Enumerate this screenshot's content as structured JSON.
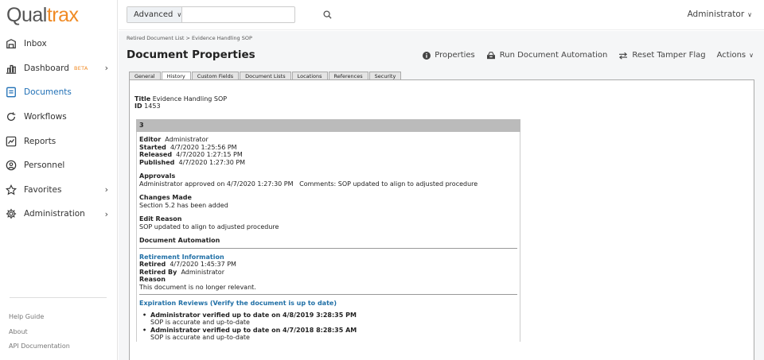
{
  "app": {
    "logo_main": "Qual",
    "logo_accent": "trax"
  },
  "search": {
    "mode": "Advanced",
    "placeholder": ""
  },
  "user": {
    "name": "Administrator"
  },
  "sidebar": {
    "items": [
      {
        "label": "Inbox",
        "icon": "inbox-icon"
      },
      {
        "label": "Dashboard",
        "badge": "BETA",
        "icon": "dashboard-icon",
        "has_children": true
      },
      {
        "label": "Documents",
        "icon": "document-icon",
        "active": true
      },
      {
        "label": "Workflows",
        "icon": "workflow-icon"
      },
      {
        "label": "Reports",
        "icon": "reports-icon"
      },
      {
        "label": "Personnel",
        "icon": "personnel-icon"
      },
      {
        "label": "Favorites",
        "icon": "star-icon",
        "has_children": true
      },
      {
        "label": "Administration",
        "icon": "gear-icon",
        "has_children": true
      }
    ],
    "footer_links": [
      "Help Guide",
      "About",
      "API Documentation"
    ]
  },
  "breadcrumb": {
    "parent": "Retired Document List",
    "separator": ">",
    "current": "Evidence Handling SOP"
  },
  "page": {
    "title": "Document Properties"
  },
  "actions": {
    "properties": "Properties",
    "run_automation": "Run Document Automation",
    "reset_tamper": "Reset Tamper Flag",
    "actions": "Actions"
  },
  "tabs": [
    "General",
    "History",
    "Custom Fields",
    "Document Lists",
    "Locations",
    "References",
    "Security"
  ],
  "active_tab": "History",
  "document": {
    "title_label": "Title",
    "title": "Evidence Handling SOP",
    "id_label": "ID",
    "id": "1453"
  },
  "history": {
    "version": "3",
    "editor_label": "Editor",
    "editor": "Administrator",
    "started_label": "Started",
    "started": "4/7/2020 1:25:56 PM",
    "released_label": "Released",
    "released": "4/7/2020 1:27:15 PM",
    "published_label": "Published",
    "published": "4/7/2020 1:27:30 PM",
    "approvals_label": "Approvals",
    "approvals": "Administrator approved on 4/7/2020 1:27:30 PM   Comments: SOP updated to align to adjusted procedure",
    "changes_label": "Changes Made",
    "changes": "Section 5.2 has been added",
    "edit_reason_label": "Edit Reason",
    "edit_reason": "SOP updated to align to adjusted procedure",
    "automation_label": "Document Automation",
    "retirement_title": "Retirement Information",
    "retired_label": "Retired",
    "retired": "4/7/2020 1:45:37 PM",
    "retired_by_label": "Retired By",
    "retired_by": "Administrator",
    "reason_label": "Reason",
    "reason": "This document is no longer relevant.",
    "expiration_title": "Expiration Reviews (Verify the document is up to date)",
    "reviews": [
      {
        "heading": "Administrator verified up to date on 4/8/2019 3:28:35 PM",
        "note": "SOP is accurate and up-to-date"
      },
      {
        "heading": "Administrator verified up to date on 4/7/2018 8:28:35 AM",
        "note": "SOP is accurate and up-to-date"
      }
    ]
  }
}
